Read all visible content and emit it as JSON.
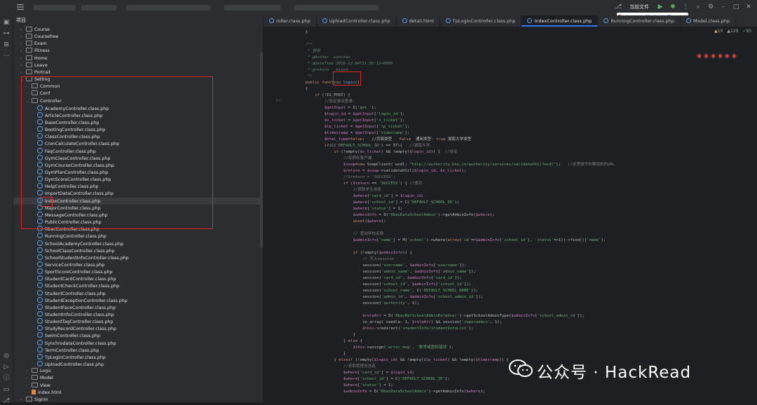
{
  "toolbar": {
    "run_config": "当前文件",
    "brand_letter": "S"
  },
  "project": {
    "title": "项目",
    "rows": [
      {
        "indent": 2,
        "type": "folder",
        "label": "Course",
        "expanded": false
      },
      {
        "indent": 2,
        "type": "folder",
        "label": "Coursefree",
        "expanded": false
      },
      {
        "indent": 2,
        "type": "folder",
        "label": "Exam",
        "expanded": false
      },
      {
        "indent": 2,
        "type": "folder",
        "label": "Fitness",
        "expanded": false
      },
      {
        "indent": 2,
        "type": "folder",
        "label": "Home",
        "expanded": false
      },
      {
        "indent": 2,
        "type": "folder",
        "label": "Leave",
        "expanded": false
      },
      {
        "indent": 2,
        "type": "folder",
        "label": "Portrait",
        "expanded": false
      },
      {
        "indent": 2,
        "type": "folder",
        "label": "Setting",
        "expanded": true
      },
      {
        "indent": 3,
        "type": "folder",
        "label": "Common",
        "expanded": false
      },
      {
        "indent": 3,
        "type": "folder",
        "label": "Conf",
        "expanded": false
      },
      {
        "indent": 3,
        "type": "folder",
        "label": "Controller",
        "expanded": true
      },
      {
        "indent": 4,
        "type": "file",
        "label": "AcademyController.class.php"
      },
      {
        "indent": 4,
        "type": "file",
        "label": "ArticleController.class.php"
      },
      {
        "indent": 4,
        "type": "file",
        "label": "BaseController.class.php"
      },
      {
        "indent": 4,
        "type": "file",
        "label": "BootingController.class.php"
      },
      {
        "indent": 4,
        "type": "file",
        "label": "ClassController.class.php"
      },
      {
        "indent": 4,
        "type": "file",
        "label": "CronCalculateController.class.php"
      },
      {
        "indent": 4,
        "type": "file",
        "label": "FaqController.class.php"
      },
      {
        "indent": 4,
        "type": "file",
        "label": "GymClassController.class.php"
      },
      {
        "indent": 4,
        "type": "file",
        "label": "GymCourseController.class.php"
      },
      {
        "indent": 4,
        "type": "file",
        "label": "GymPlanController.class.php"
      },
      {
        "indent": 4,
        "type": "file",
        "label": "GymScoreController.class.php"
      },
      {
        "indent": 4,
        "type": "file",
        "label": "HelpController.class.php"
      },
      {
        "indent": 4,
        "type": "file",
        "label": "ImportDataController.class.php"
      },
      {
        "indent": 4,
        "type": "file",
        "label": "IndexController.class.php",
        "selected": true
      },
      {
        "indent": 4,
        "type": "file",
        "label": "MajorController.class.php"
      },
      {
        "indent": 4,
        "type": "file",
        "label": "MessageController.class.php"
      },
      {
        "indent": 4,
        "type": "file",
        "label": "PublicController.class.php"
      },
      {
        "indent": 4,
        "type": "file",
        "label": "RbacController.class.php"
      },
      {
        "indent": 4,
        "type": "file",
        "label": "RunningController.class.php"
      },
      {
        "indent": 4,
        "type": "file",
        "label": "SchoolAcademyController.class.php"
      },
      {
        "indent": 4,
        "type": "file",
        "label": "SchoolClassController.class.php"
      },
      {
        "indent": 4,
        "type": "file",
        "label": "SchoolStudentInfoController.class.php"
      },
      {
        "indent": 4,
        "type": "file",
        "label": "ServiceController.class.php"
      },
      {
        "indent": 4,
        "type": "file",
        "label": "SportScoreController.class.php"
      },
      {
        "indent": 4,
        "type": "file",
        "label": "StudentCardController.class.php"
      },
      {
        "indent": 4,
        "type": "file",
        "label": "StudentCheckController.class.php"
      },
      {
        "indent": 4,
        "type": "file",
        "label": "StudentController.class.php"
      },
      {
        "indent": 4,
        "type": "file",
        "label": "StudentExceptionController.class.php"
      },
      {
        "indent": 4,
        "type": "file",
        "label": "StudentFaceController.class.php"
      },
      {
        "indent": 4,
        "type": "file",
        "label": "StudentInfoController.class.php"
      },
      {
        "indent": 4,
        "type": "file",
        "label": "StudentTagController.class.php"
      },
      {
        "indent": 4,
        "type": "file",
        "label": "StudyRecordController.class.php"
      },
      {
        "indent": 4,
        "type": "file",
        "label": "SwimController.class.php"
      },
      {
        "indent": 4,
        "type": "file",
        "label": "SynchrodataController.class.php"
      },
      {
        "indent": 4,
        "type": "file",
        "label": "TermController.class.php"
      },
      {
        "indent": 4,
        "type": "file",
        "label": "TpLoginController.class.php"
      },
      {
        "indent": 4,
        "type": "file",
        "label": "UploadController.class.php"
      },
      {
        "indent": 3,
        "type": "folder",
        "label": "Logic",
        "expanded": false
      },
      {
        "indent": 3,
        "type": "folder",
        "label": "Model",
        "expanded": false
      },
      {
        "indent": 3,
        "type": "folder",
        "label": "View",
        "expanded": false
      },
      {
        "indent": 3,
        "type": "html",
        "label": "index.html"
      },
      {
        "indent": 2,
        "type": "folder",
        "label": "Signin",
        "expanded": false
      }
    ]
  },
  "tabs": [
    {
      "label": "roller.class.php",
      "active": false
    },
    {
      "label": "UploadController.class.php",
      "active": false
    },
    {
      "label": "detail.html",
      "active": false
    },
    {
      "label": "TpLoginController.class.php",
      "active": false
    },
    {
      "label": "IndexController.class.php",
      "active": true
    },
    {
      "label": "RunningController.class.php",
      "active": false
    },
    {
      "label": "Model.class.php",
      "active": false
    }
  ],
  "inspections": {
    "warnings": "10",
    "weak": "129",
    "typos": "93"
  },
  "line_numbers": [
    "",
    "",
    "",
    "",
    "",
    "",
    "",
    "",
    "",
    "",
    "53",
    "",
    "",
    "",
    "",
    "",
    "",
    "",
    "",
    "",
    "",
    "",
    "",
    "",
    "",
    "",
    "",
    "",
    "",
    "",
    "",
    "",
    "",
    "",
    "",
    "",
    "",
    "",
    "",
    "",
    "",
    "",
    "",
    "",
    "",
    "",
    "",
    "",
    "",
    "",
    "",
    "",
    "",
    "",
    "",
    "",
    "",
    "",
    ""
  ],
  "code": [
    {
      "i": 4,
      "t": "}"
    },
    {
      "i": 0,
      "t": ""
    },
    {
      "i": 4,
      "t": "/**",
      "cls": "d"
    },
    {
      "i": 4,
      "t": " * 登录",
      "cls": "d"
    },
    {
      "i": 4,
      "t": " * @Author  wanchao",
      "cls": "d"
    },
    {
      "i": 4,
      "t": " * @DateTime 2016-12-04T11:38:12+0800",
      "cls": "d"
    },
    {
      "i": 4,
      "t": " * @return   mixed",
      "cls": "d"
    },
    {
      "i": 4,
      "t": " */",
      "cls": "d"
    },
    {
      "i": 4,
      "t": "public function login()",
      "fn": "login"
    },
    {
      "i": 4,
      "t": "{"
    },
    {
      "i": 8,
      "t": "if (!IS_POST) {"
    },
    {
      "i": 12,
      "t": "//验证单点登录",
      "cls": "c"
    },
    {
      "i": 12,
      "t": "$getInput = I('get.');"
    },
    {
      "i": 12,
      "t": "$login_id = $getInput['login_id'];"
    },
    {
      "i": 12,
      "t": "$s_ticket = $getInput['s_ticket'];"
    },
    {
      "i": 12,
      "t": "$lp_ticket = $getInput['lp_ticket'];"
    },
    {
      "i": 12,
      "t": "$timestamp = $getInput['timestamp'];"
    },
    {
      "i": 12,
      "t": "$html_type=false;   //页面类型   false  通用类型- true 湖南大学类型"
    },
    {
      "i": 12,
      "t": "if(C('DEFAULT_SCHOOL_ID') == 37){   //湖南大学"
    },
    {
      "i": 16,
      "t": "if (!empty($s_ticket) && !empty($login_id)) {  //验证"
    },
    {
      "i": 20,
      "t": "//实例化客户端",
      "cls": "c"
    },
    {
      "i": 20,
      "t": "$soap=new SoapClient( wsdl: \"http://authority.hnu.cn/authority/services/validateUtil?wsdl\");   //这里填写你要调用的URL"
    },
    {
      "i": 20,
      "t": "$return = $soap->validateUtil($login_id, $s_ticket);"
    },
    {
      "i": 20,
      "t": "//$return = 'SUCCESS';",
      "cls": "c"
    },
    {
      "i": 20,
      "t": "if ($return == 'SUCCESS') { //成功"
    },
    {
      "i": 24,
      "t": "//获取学生信息",
      "cls": "c"
    },
    {
      "i": 24,
      "t": "$where['card_id'] = $login_id;"
    },
    {
      "i": 24,
      "t": "$where['school_id'] = C('DEFAULT_SCHOOL_ID');"
    },
    {
      "i": 24,
      "t": "$where['status'] = 1;"
    },
    {
      "i": 24,
      "t": "$adminInfo = D('RbacDataSchoolAdmin')->getAdminInfo($where);"
    },
    {
      "i": 24,
      "t": "unset($where);"
    },
    {
      "i": 0,
      "t": ""
    },
    {
      "i": 24,
      "t": "// 查询学校名称",
      "cls": "c"
    },
    {
      "i": 24,
      "t": "$adminInfo['name'] = M('school')->where(array('id'=>$adminInfo['school_id'], 'status'=>1))->find()['name'];"
    },
    {
      "i": 0,
      "t": ""
    },
    {
      "i": 24,
      "t": "if (!empty($adminInfo)) {"
    },
    {
      "i": 28,
      "t": "// 写入session",
      "cls": "c"
    },
    {
      "i": 28,
      "t": "session('username', $adminInfo['username']);"
    },
    {
      "i": 28,
      "t": "session('admin_name', $adminInfo['admin_name']);"
    },
    {
      "i": 28,
      "t": "session('card_id', $adminInfo['card_id']);"
    },
    {
      "i": 28,
      "t": "session('school_id', $adminInfo['school_id']);"
    },
    {
      "i": 28,
      "t": "session('school_name', C('DEFAULT_SCHOOL_NAME'));"
    },
    {
      "i": 28,
      "t": "session('admin_id', $adminInfo['school_admin_id']);"
    },
    {
      "i": 28,
      "t": "session('authority', 1);"
    },
    {
      "i": 0,
      "t": ""
    },
    {
      "i": 28,
      "t": "$roleArr = D('RbacRelSchoolAdminRoleUser')->getSchoolAdminType($adminInfo['school_admin_id']);"
    },
    {
      "i": 28,
      "t": "in_array( needle: 1, $roleArr) && session('superadmin', 1);"
    },
    {
      "i": 28,
      "t": "$this->redirect('studentInfo/studentInfoList');"
    },
    {
      "i": 24,
      "t": "}"
    },
    {
      "i": 20,
      "t": "} else {"
    },
    {
      "i": 24,
      "t": "$this->assign('error_msg', '账号或密码错误');"
    },
    {
      "i": 20,
      "t": "}"
    },
    {
      "i": 16,
      "t": "} elseif (!empty($login_id) && !empty($lp_ticket) && !empty($timestamp)) {"
    },
    {
      "i": 20,
      "t": "//获取管理员信息",
      "cls": "c"
    },
    {
      "i": 20,
      "t": "$where['card_id'] = $login_id;"
    },
    {
      "i": 20,
      "t": "$where['school_id'] = C('DEFAULT_SCHOOL_ID');"
    },
    {
      "i": 20,
      "t": "$where['status'] = 1;"
    },
    {
      "i": 20,
      "t": "$adminInfo = D('RbacDataSchoolAdmin')->getAdminInfo($where);"
    }
  ],
  "watermark": {
    "text": "公众号 · HackRead"
  }
}
